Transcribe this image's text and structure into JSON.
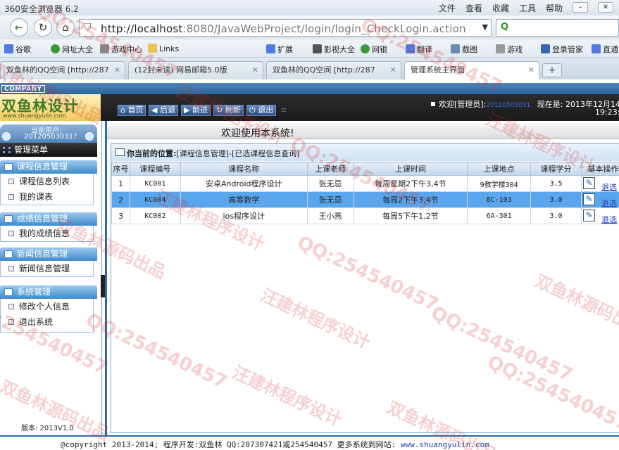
{
  "browser": {
    "title": "360安全浏览器 6.2",
    "menu": [
      "文件",
      "查看",
      "收藏",
      "工具",
      "帮助"
    ],
    "url_host": "http://localhost",
    "url_rest": ":8080/JavaWebProject/login/login_CheckLogin.action",
    "favorites": [
      "谷歌",
      "网址大全",
      "游戏中心",
      "Links",
      "扩展",
      "影视大全",
      "网银",
      "翻译",
      "截图",
      "游戏",
      "登录管家",
      "直通"
    ],
    "tabs": [
      {
        "label": "双鱼林的QQ空间 [http://287",
        "active": false
      },
      {
        "label": "(12封未读) 网易邮箱5.0版",
        "active": false
      },
      {
        "label": "双鱼林的QQ空间 [http://287",
        "active": false
      },
      {
        "label": "管理系统主界面",
        "active": true
      }
    ]
  },
  "header": {
    "company": "COMPANY",
    "logo_text": "双鱼林设计",
    "logo_url": "www.shuangyulin.com",
    "nav": [
      "首页",
      "后退",
      "前进",
      "刷新",
      "退出"
    ],
    "welcome_prefix": "欢迎[管理员]:",
    "admin_id": "20120503031",
    "time_label": "现在是: 2013年12月14",
    "time_clock": "19:23:"
  },
  "sidebar": {
    "user_label": "当前用户:",
    "user_id": "20120503031?",
    "menu_title": "管理菜单",
    "sections": [
      {
        "title": "课程信息管理",
        "items": [
          "课程信息列表",
          "我的课表"
        ]
      },
      {
        "title": "成绩信息管理",
        "items": [
          "我的成绩信息"
        ]
      },
      {
        "title": "新闻信息管理",
        "items": [
          "新闻信息管理"
        ]
      },
      {
        "title": "系统管理",
        "items": [
          "修改个人信息",
          "退出系统"
        ]
      }
    ],
    "version": "版本: 2013V1.0"
  },
  "main": {
    "welcome": "欢迎使用本系统!",
    "location_label": "你当前的位置:",
    "location_path": "[课程信息管理]-[已选课程信息查询]",
    "columns": [
      "序号",
      "课程编号",
      "课程名称",
      "上课老师",
      "上课时间",
      "上课地点",
      "课程学分",
      "基本操作"
    ],
    "rows": [
      {
        "no": "1",
        "code": "KC001",
        "name": "安卓Android程序设计",
        "teacher": "张无忌",
        "time": "每周星期2下午3,4节",
        "place": "9教学楼304",
        "credit": "3.5",
        "action": "退选",
        "selected": false
      },
      {
        "no": "2",
        "code": "KC004",
        "name": "高等数学",
        "teacher": "张无忌",
        "time": "每周2下午3,4节",
        "place": "8C-103",
        "credit": "3.0",
        "action": "退选",
        "selected": true
      },
      {
        "no": "3",
        "code": "KC002",
        "name": "ios程序设计",
        "teacher": "王小燕",
        "time": "每周5下午1,2节",
        "place": "6A-301",
        "credit": "3.0",
        "action": "退选",
        "selected": false
      }
    ]
  },
  "footer": {
    "text": "@copyright 2013-2014; 程序开发:双鱼林  QQ:287307421或254540457  更多系统到网站:",
    "link": "www.shuangyulin.com"
  },
  "watermarks": [
    "双鱼林源码出品",
    "汪建林程序设计",
    "QQ:254540457"
  ],
  "colors": {
    "accent": "#2d6aa6",
    "selected_row": "#5aa6ee",
    "watermark": "#dc2828"
  }
}
